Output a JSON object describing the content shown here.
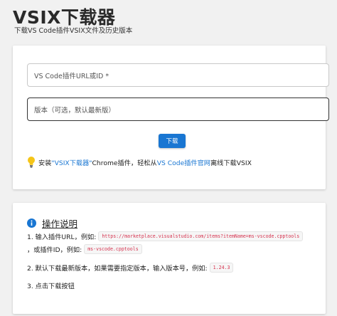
{
  "header": {
    "title": "VSIX下载器",
    "subtitle": "下载VS Code插件VSIX文件及历史版本"
  },
  "form": {
    "url_placeholder": "VS Code插件URL或ID *",
    "version_placeholder": "版本（可选，默认最新版）",
    "download_label": "下载",
    "promo": {
      "prefix": "安装 ",
      "chrome_link": "\"VSIX下载器\"",
      "middle": " Chrome插件，轻松从 ",
      "store_link": "VS Code插件官网",
      "suffix": " 离线下载VSIX"
    }
  },
  "help": {
    "title": "操作说明",
    "step1_prefix": "1. 输入插件URL，例如:",
    "step1_url_example": "https://marketplace.visualstudio.com/items?itemName=ms-vscode.cpptools",
    "step1b_prefix": "，或插件ID，例如:",
    "step1_id_example": "ms-vscode.cpptools",
    "step2_prefix": "2. 默认下载最新版本，如果需要指定版本，输入版本号，例如:",
    "step2_version_example": "1.24.3",
    "step3": "3. 点击下载按钮"
  },
  "colors": {
    "accent": "#1976d2",
    "code_text": "#d6334f",
    "bulb": "#f5c518"
  },
  "icons": {
    "bulb": "lightbulb-icon",
    "info": "info-icon"
  }
}
